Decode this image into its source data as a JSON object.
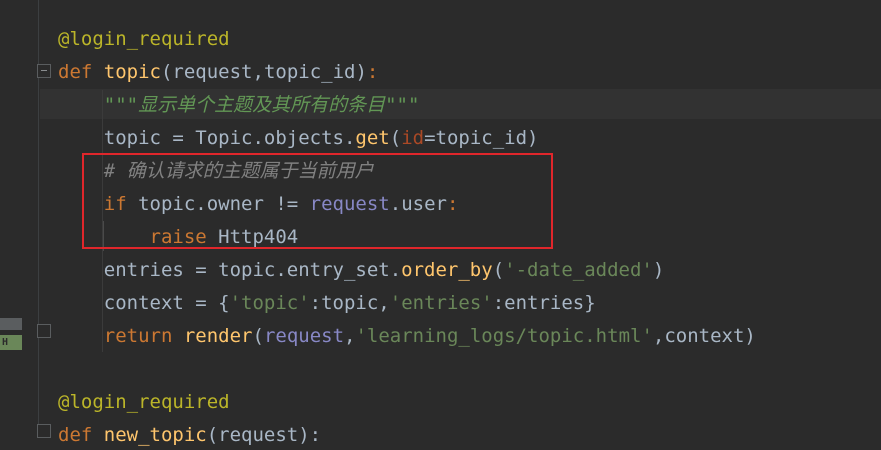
{
  "editor": {
    "lines": [
      {
        "id": "l1",
        "tokens": [
          {
            "cls": "dec",
            "text": "@login_required"
          }
        ]
      },
      {
        "id": "l2",
        "tokens": [
          {
            "cls": "kw",
            "text": "def "
          },
          {
            "cls": "fn",
            "text": "topic"
          },
          {
            "cls": "plain",
            "text": "("
          },
          {
            "cls": "param",
            "text": "request"
          },
          {
            "cls": "plain",
            "text": ","
          },
          {
            "cls": "param",
            "text": "topic_id"
          },
          {
            "cls": "plain",
            "text": ")"
          },
          {
            "cls": "kw",
            "text": ":"
          }
        ]
      },
      {
        "id": "l3",
        "tokens": [
          {
            "cls": "doc",
            "text": "    \"\"\"显示单个主题及其所有的条目\"\"\""
          }
        ]
      },
      {
        "id": "l4",
        "tokens": [
          {
            "cls": "plain",
            "text": "    topic = Topic.objects."
          },
          {
            "cls": "fn",
            "text": "get"
          },
          {
            "cls": "plain",
            "text": "("
          },
          {
            "cls": "named",
            "text": "id"
          },
          {
            "cls": "plain",
            "text": "=topic_id)"
          }
        ]
      },
      {
        "id": "l5",
        "tokens": [
          {
            "cls": "cmt",
            "text": "    # 确认请求的主题属于当前用户"
          }
        ]
      },
      {
        "id": "l6",
        "tokens": [
          {
            "cls": "kw",
            "text": "    if "
          },
          {
            "cls": "plain",
            "text": "topic.owner != "
          },
          {
            "cls": "builtin",
            "text": "request"
          },
          {
            "cls": "plain",
            "text": ".user"
          },
          {
            "cls": "kw",
            "text": ":"
          }
        ]
      },
      {
        "id": "l7",
        "tokens": [
          {
            "cls": "kw",
            "text": "        raise "
          },
          {
            "cls": "plain",
            "text": "Http404"
          }
        ]
      },
      {
        "id": "l8",
        "tokens": [
          {
            "cls": "plain",
            "text": "    entries = topic.entry_set."
          },
          {
            "cls": "fn",
            "text": "order_by"
          },
          {
            "cls": "plain",
            "text": "("
          },
          {
            "cls": "str",
            "text": "'-date_added'"
          },
          {
            "cls": "plain",
            "text": ")"
          }
        ]
      },
      {
        "id": "l9",
        "tokens": [
          {
            "cls": "plain",
            "text": "    context = {"
          },
          {
            "cls": "str",
            "text": "'topic'"
          },
          {
            "cls": "plain",
            "text": ":topic,"
          },
          {
            "cls": "str",
            "text": "'entries'"
          },
          {
            "cls": "plain",
            "text": ":entries}"
          }
        ]
      },
      {
        "id": "l10",
        "tokens": [
          {
            "cls": "kw",
            "text": "    return "
          },
          {
            "cls": "fn",
            "text": "render"
          },
          {
            "cls": "plain",
            "text": "("
          },
          {
            "cls": "builtin",
            "text": "request"
          },
          {
            "cls": "plain",
            "text": ","
          },
          {
            "cls": "str",
            "text": "'learning_logs/topic.html'"
          },
          {
            "cls": "plain",
            "text": ",context)"
          }
        ]
      },
      {
        "id": "l11",
        "tokens": []
      },
      {
        "id": "l12",
        "tokens": [
          {
            "cls": "dec",
            "text": "@login_required"
          }
        ]
      },
      {
        "id": "l13",
        "tokens": [
          {
            "cls": "kw",
            "text": "def "
          },
          {
            "cls": "fn",
            "text": "new_topic"
          },
          {
            "cls": "plain",
            "text": "(request):"
          }
        ]
      }
    ]
  },
  "gutter": {
    "mark_label": "H"
  },
  "colors": {
    "background": "#2b2b2b",
    "highlight_box": "#e0262b",
    "keyword": "#cc7832",
    "string": "#6a8759",
    "comment": "#808080",
    "function": "#ffc66d",
    "decorator": "#bbb529"
  }
}
